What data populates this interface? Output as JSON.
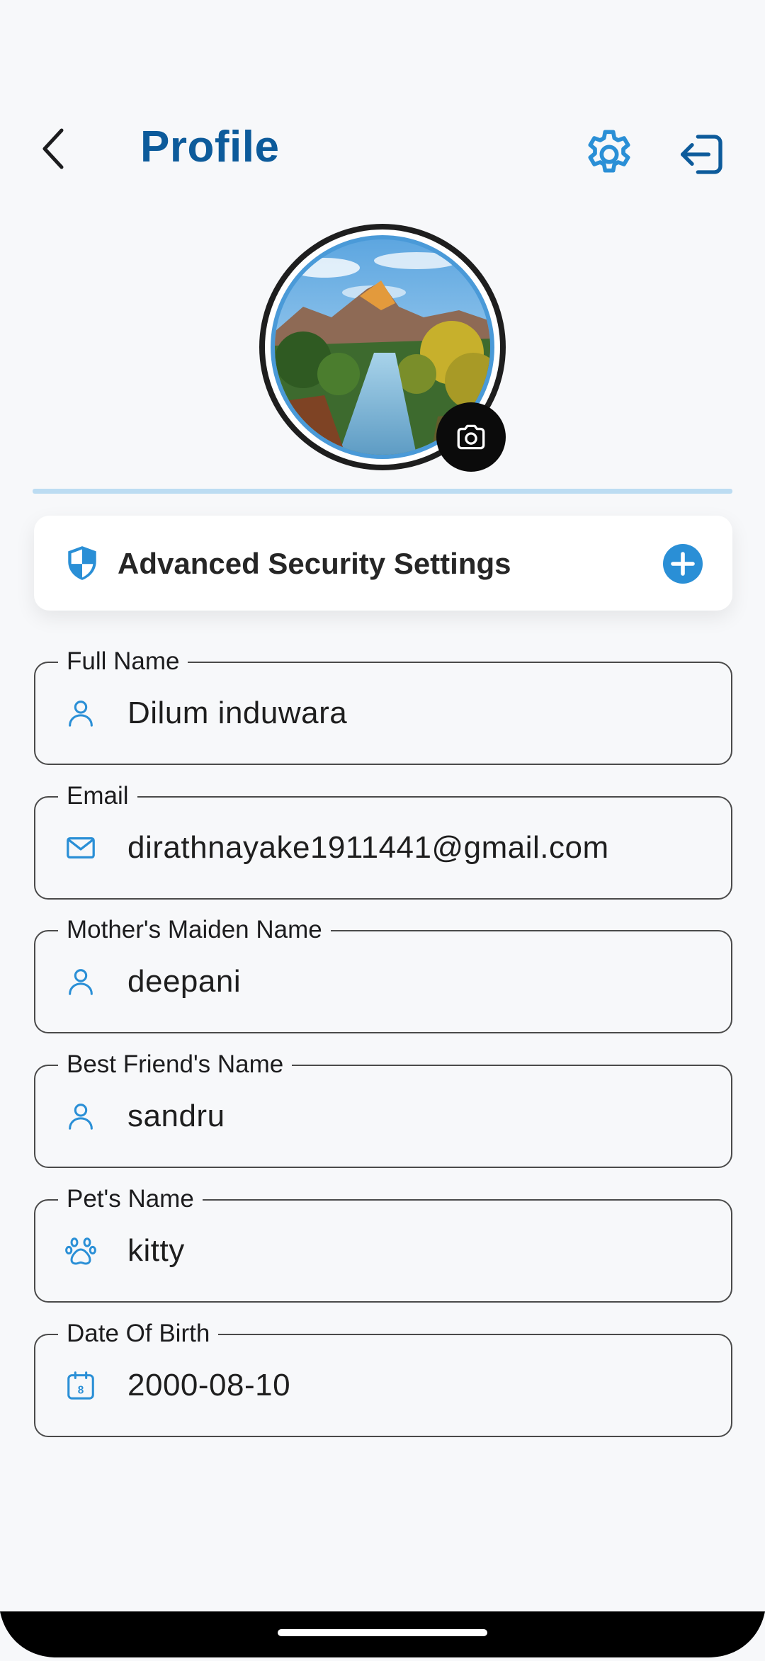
{
  "header": {
    "title": "Profile",
    "back_icon": "chevron-left-icon",
    "settings_icon": "gear-icon",
    "logout_icon": "logout-icon"
  },
  "avatar": {
    "image": "landscape-mountain-river-photo",
    "camera_icon": "camera-icon"
  },
  "security": {
    "label": "Advanced Security Settings",
    "icon": "shield-icon",
    "action_icon": "plus-circle-icon"
  },
  "fields": [
    {
      "label": "Full Name",
      "value": "Dilum induwara",
      "icon": "person-icon"
    },
    {
      "label": "Email",
      "value": "dirathnayake1911441@gmail.com",
      "icon": "mail-icon"
    },
    {
      "label": "Mother's Maiden Name",
      "value": "deepani",
      "icon": "person-icon"
    },
    {
      "label": "Best Friend's Name",
      "value": "sandru",
      "icon": "person-icon"
    },
    {
      "label": "Pet's Name",
      "value": "kitty",
      "icon": "paw-icon"
    },
    {
      "label": "Date Of Birth",
      "value": "2000-08-10",
      "icon": "calendar-icon",
      "icon_text": "8"
    }
  ],
  "colors": {
    "title": "#0d5b9b",
    "accent": "#2a8fd6",
    "divider": "#bcdcf2",
    "background": "#f7f8fa"
  }
}
